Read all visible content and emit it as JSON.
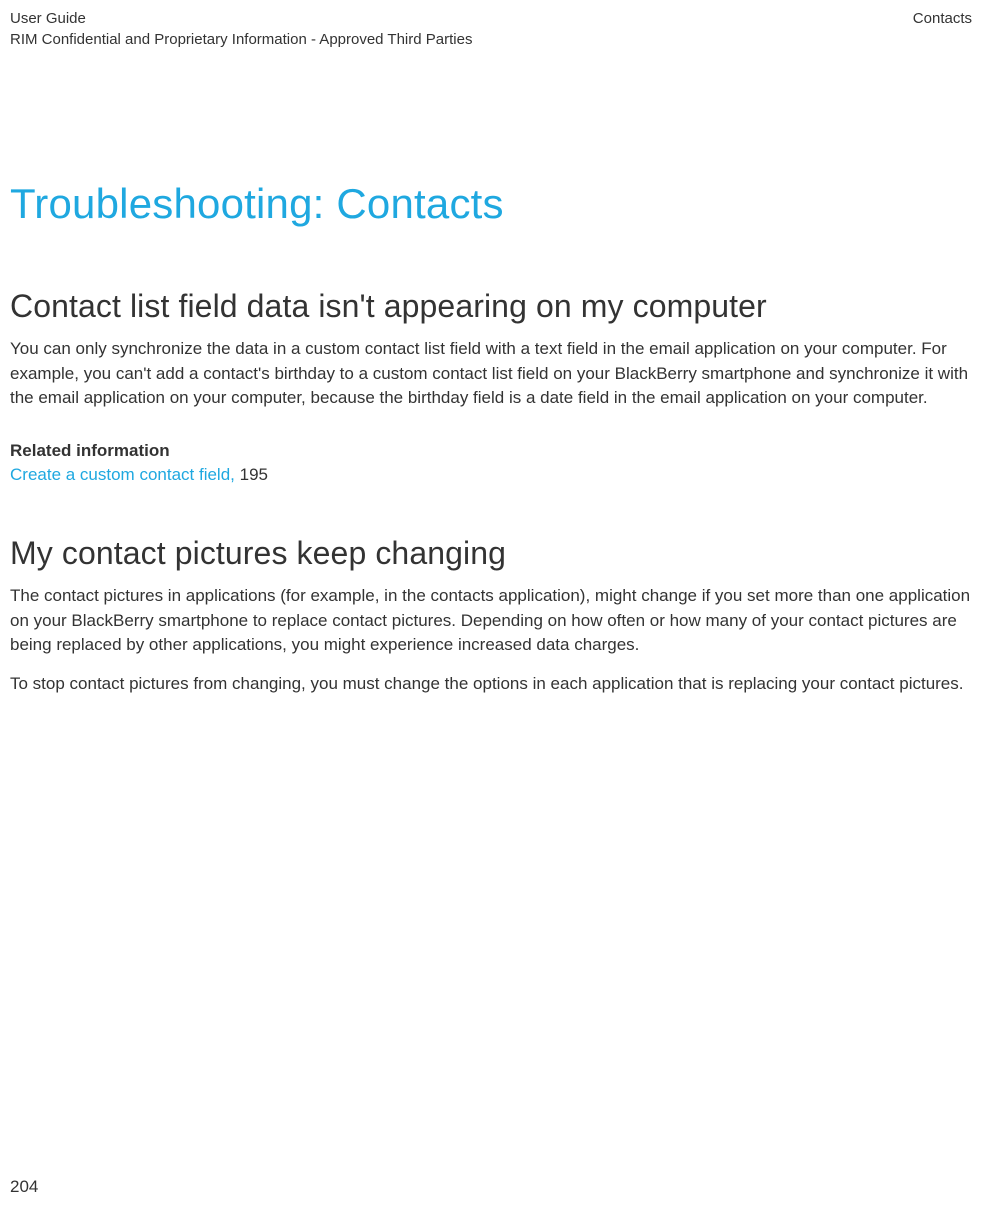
{
  "header": {
    "doc_title": "User Guide",
    "confidentiality": "RIM Confidential and Proprietary Information - Approved Third Parties",
    "section_name": "Contacts"
  },
  "main_title": "Troubleshooting: Contacts",
  "section1": {
    "heading": "Contact list field data isn't appearing on my computer",
    "paragraph": "You can only synchronize the data in a custom contact list field with a text field in the email application on your computer. For example, you can't add a contact's birthday to a custom contact list field on your BlackBerry smartphone and synchronize it with the email application on your computer, because the birthday field is a date field in the email application on your computer.",
    "related_heading": "Related information",
    "related_link_text": "Create a custom contact field, ",
    "related_link_page": "195"
  },
  "section2": {
    "heading": "My contact pictures keep changing",
    "paragraph1": "The contact pictures in applications (for example, in the contacts application), might change if you set more than one application on your BlackBerry smartphone to replace contact pictures. Depending on how often or how many of your contact pictures are being replaced by other applications, you might experience increased data charges.",
    "paragraph2": "To stop contact pictures from changing, you must change the options in each application that is replacing your contact pictures."
  },
  "page_number": "204"
}
